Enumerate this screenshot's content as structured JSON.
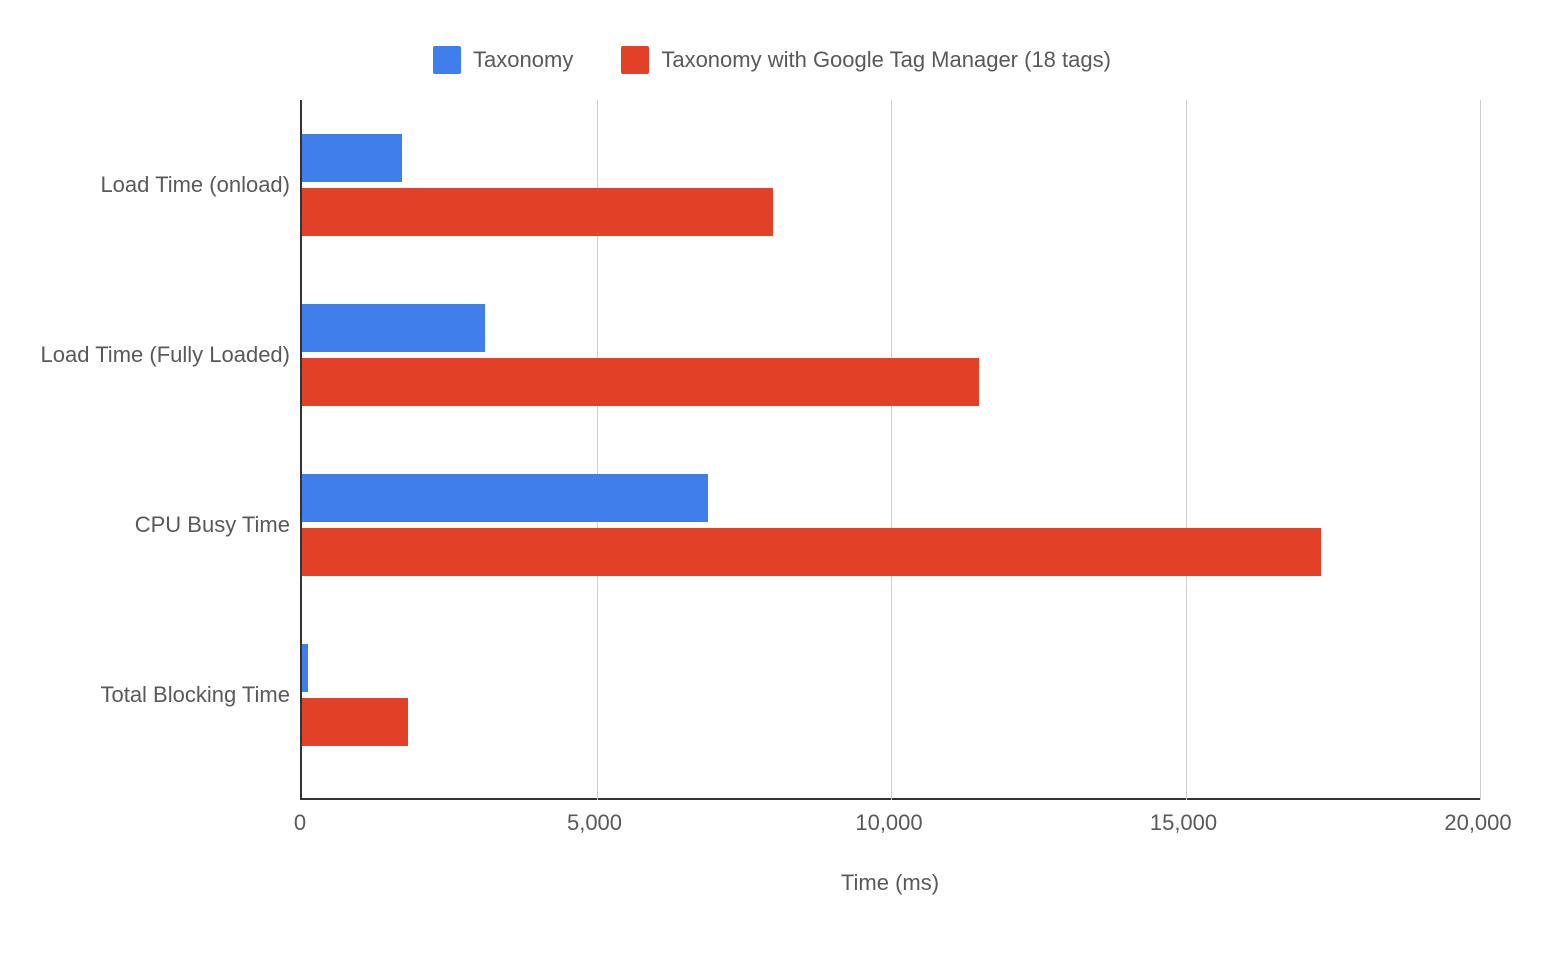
{
  "chart_data": {
    "type": "bar",
    "orientation": "horizontal",
    "categories": [
      "Load Time (onload)",
      "Load Time (Fully Loaded)",
      "CPU Busy Time",
      "Total Blocking Time"
    ],
    "series": [
      {
        "name": "Taxonomy",
        "color": "#3f7eeb",
        "values": [
          1700,
          3100,
          6900,
          100
        ]
      },
      {
        "name": "Taxonomy with Google Tag Manager (18 tags)",
        "color": "#e04127",
        "values": [
          8000,
          11500,
          17300,
          1800
        ]
      }
    ],
    "xlabel": "Time (ms)",
    "ylabel": "",
    "xlim": [
      0,
      20000
    ],
    "x_ticks": [
      0,
      5000,
      10000,
      15000,
      20000
    ],
    "x_tick_labels": [
      "0",
      "5,000",
      "10,000",
      "15,000",
      "20,000"
    ],
    "grid": true,
    "legend_position": "top"
  }
}
